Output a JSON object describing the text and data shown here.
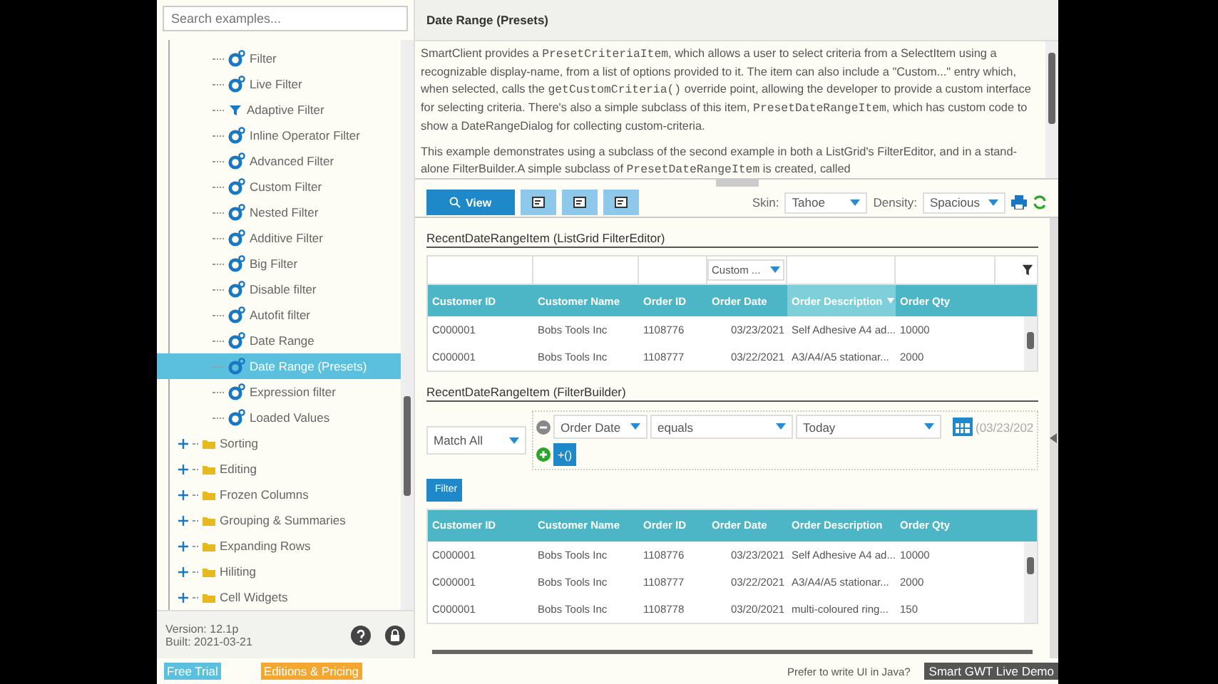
{
  "sidebar": {
    "search": {
      "placeholder": "Search examples..."
    },
    "open_branch": [
      {
        "label": "Filter",
        "kind": "gear",
        "selected": false
      },
      {
        "label": "Live Filter",
        "kind": "gear",
        "selected": false
      },
      {
        "label": "Adaptive Filter",
        "kind": "funnel",
        "selected": false
      },
      {
        "label": "Inline Operator Filter",
        "kind": "gear",
        "selected": false
      },
      {
        "label": "Advanced Filter",
        "kind": "gear",
        "selected": false
      },
      {
        "label": "Custom Filter",
        "kind": "gear",
        "selected": false
      },
      {
        "label": "Nested Filter",
        "kind": "gear",
        "selected": false
      },
      {
        "label": "Additive Filter",
        "kind": "gear",
        "selected": false
      },
      {
        "label": "Big Filter",
        "kind": "gear",
        "selected": false
      },
      {
        "label": "Disable filter",
        "kind": "gear",
        "selected": false
      },
      {
        "label": "Autofit filter",
        "kind": "gear",
        "selected": false
      },
      {
        "label": "Date Range",
        "kind": "gear",
        "selected": false
      },
      {
        "label": "Date Range (Presets)",
        "kind": "gear",
        "selected": true
      },
      {
        "label": "Expression filter",
        "kind": "gear",
        "selected": false
      },
      {
        "label": "Loaded Values",
        "kind": "gear",
        "selected": false
      }
    ],
    "folders": [
      {
        "label": "Sorting",
        "expanded": false
      },
      {
        "label": "Editing",
        "expanded": false
      },
      {
        "label": "Frozen Columns",
        "expanded": false
      },
      {
        "label": "Grouping & Summaries",
        "expanded": false
      },
      {
        "label": "Expanding Rows",
        "expanded": false
      },
      {
        "label": "Hiliting",
        "expanded": false
      },
      {
        "label": "Cell Widgets",
        "expanded": false
      }
    ],
    "version": "Version: 12.1p",
    "built": "Built: 2021-03-21"
  },
  "title": "Date Range (Presets)",
  "description": [
    [
      {
        "kind": "text",
        "text": "SmartClient provides a "
      },
      {
        "kind": "code",
        "text": "PresetCriteriaItem"
      },
      {
        "kind": "text",
        "text": ", which allows a user to select criteria from a SelectItem using a recognizable display-name, from a list of options provided to it. The item can also include a \"Custom...\" entry which, when selected, calls the "
      },
      {
        "kind": "code",
        "text": "getCustomCriteria()"
      },
      {
        "kind": "text",
        "text": " override point, allowing the developer to provide a custom interface for selecting criteria. There's also a simple subclass of this item, "
      },
      {
        "kind": "code",
        "text": "PresetDateRangeItem"
      },
      {
        "kind": "text",
        "text": ", which has custom code to show a DateRangeDialog for collecting custom-criteria."
      }
    ],
    [
      {
        "kind": "text",
        "text": "This example demonstrates using a subclass of the second example in both a ListGrid's FilterEditor, and in a stand-alone FilterBuilder.A simple subclass of "
      },
      {
        "kind": "code",
        "text": "PresetDateRangeItem"
      },
      {
        "kind": "text",
        "text": " is created, called"
      }
    ]
  ],
  "toolbar": {
    "view_button": "View",
    "skin_label": "Skin:",
    "skin": "Tahoe",
    "density_label": "Density:",
    "density": "Spacious"
  },
  "grid_section": {
    "title": "RecentDateRangeItem (ListGrid FilterEditor)",
    "columns": [
      {
        "label": "Customer ID",
        "sorted": false
      },
      {
        "label": "Customer Name",
        "sorted": false
      },
      {
        "label": "Order ID",
        "sorted": false
      },
      {
        "label": "Order Date",
        "sorted": false,
        "filter": "Custom ..."
      },
      {
        "label": "Order Description",
        "sorted": true
      },
      {
        "label": "Order Qty",
        "sorted": false
      }
    ],
    "rows": [
      [
        "C000001",
        "Bobs Tools Inc",
        "1108776",
        "03/23/2021",
        "Self Adhesive A4 ad...",
        "10000"
      ],
      [
        "C000001",
        "Bobs Tools Inc",
        "1108777",
        "03/22/2021",
        "A3/A4/A5 stationar...",
        "2000"
      ]
    ]
  },
  "builder_section": {
    "title": "RecentDateRangeItem (FilterBuilder)",
    "match": "Match All",
    "field": "Order Date",
    "operator": "equals",
    "value": "Today",
    "date": "(03/23/202",
    "add_label": "+()",
    "filter_button": "Filter",
    "columns": [
      "Customer ID",
      "Customer Name",
      "Order ID",
      "Order Date",
      "Order Description",
      "Order Qty"
    ],
    "rows": [
      [
        "C000001",
        "Bobs Tools Inc",
        "1108776",
        "03/23/2021",
        "Self Adhesive A4 ad...",
        "10000"
      ],
      [
        "C000001",
        "Bobs Tools Inc",
        "1108777",
        "03/22/2021",
        "A3/A4/A5 stationar...",
        "2000"
      ],
      [
        "C000001",
        "Bobs Tools Inc",
        "1108778",
        "03/20/2021",
        "multi-coloured ring...",
        "150"
      ]
    ]
  },
  "footer": {
    "free_trial": "Free Trial",
    "pricing": "Editions & Pricing",
    "prompt": "Prefer to write UI in Java?",
    "live_demo": "Smart GWT Live Demo"
  }
}
